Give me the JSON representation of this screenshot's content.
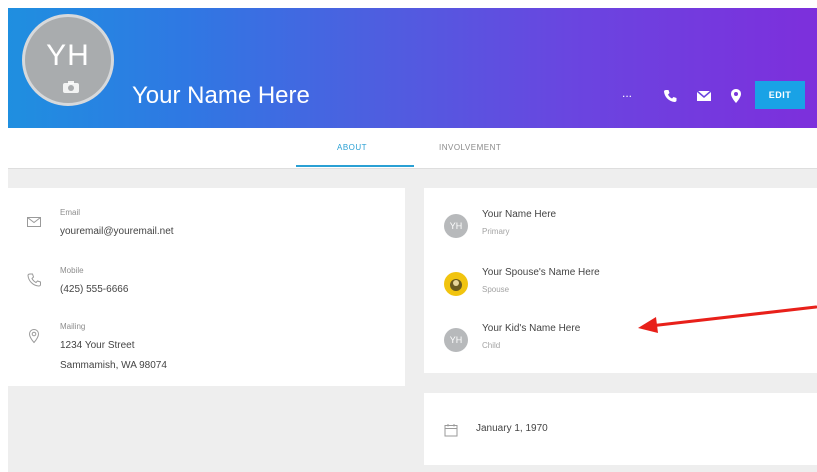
{
  "header": {
    "avatar_initials": "YH",
    "name": "Your Name Here",
    "more_label": "...",
    "edit_label": "EDIT",
    "gradient_colors": [
      "#1f8fe0",
      "#7d2fdc"
    ]
  },
  "tabs": [
    {
      "label": "ABOUT",
      "active": true
    },
    {
      "label": "INVOLVEMENT",
      "active": false
    }
  ],
  "contact": {
    "email": {
      "label": "Email",
      "value": "youremail@youremail.net",
      "icon": "envelope-icon"
    },
    "mobile": {
      "label": "Mobile",
      "value": "(425) 555-6666",
      "icon": "phone-icon"
    },
    "mailing": {
      "label": "Mailing",
      "line1": "1234 Your Street",
      "line2": "Sammamish, WA 98074",
      "icon": "location-pin-icon"
    }
  },
  "family": [
    {
      "initials": "YH",
      "name": "Your Name Here",
      "role": "Primary"
    },
    {
      "initials": "",
      "name": "Your Spouse's Name Here",
      "role": "Spouse"
    },
    {
      "initials": "YH",
      "name": "Your Kid's Name Here",
      "role": "Child"
    }
  ],
  "birthday": {
    "date": "January 1, 1970",
    "icon": "calendar-icon"
  },
  "colors": {
    "accent": "#2aa0d4",
    "edit_button": "#19a2e6",
    "annotation_arrow": "#e8201a"
  }
}
